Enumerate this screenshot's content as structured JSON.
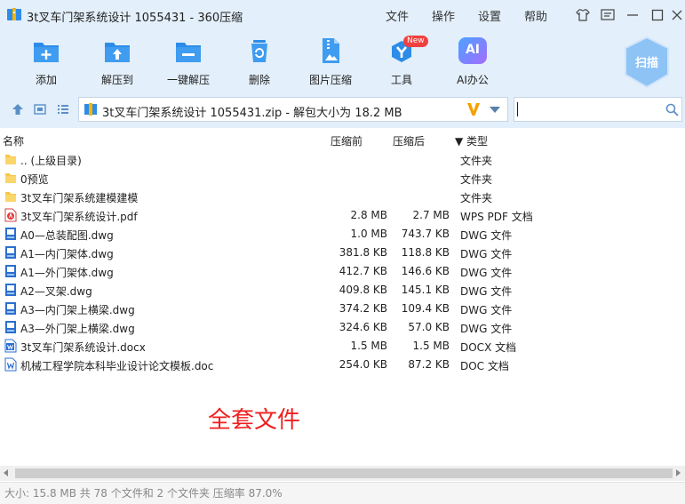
{
  "window": {
    "title": "3t叉车门架系统设计 1055431 - 360压缩",
    "menu": [
      "文件",
      "操作",
      "设置",
      "帮助"
    ],
    "accent": "#2d8ce8",
    "bar_color": "#e3effa"
  },
  "toolbar": {
    "tools": [
      {
        "label": "添加",
        "icon": "add-folder-icon"
      },
      {
        "label": "解压到",
        "icon": "extract-to-icon"
      },
      {
        "label": "一键解压",
        "icon": "one-click-extract-icon"
      },
      {
        "label": "删除",
        "icon": "trash-icon"
      },
      {
        "label": "图片压缩",
        "icon": "image-compress-icon"
      },
      {
        "label": "工具",
        "icon": "tools-icon",
        "badge": "New"
      },
      {
        "label": "AI办公",
        "icon": "ai-office-icon",
        "glyph": "AI"
      }
    ],
    "scan_label": "扫描"
  },
  "address": {
    "path": "3t叉车门架系统设计 1055431.zip - 解包大小为 18.2 MB",
    "search_placeholder": ""
  },
  "columns": {
    "name": "名称",
    "size": "压缩前",
    "packed": "压缩后",
    "type": "▼ 类型"
  },
  "files": [
    {
      "name": ".. (上级目录)",
      "size": "",
      "packed": "",
      "type": "文件夹",
      "icon": "folder-icon"
    },
    {
      "name": "0预览",
      "size": "",
      "packed": "",
      "type": "文件夹",
      "icon": "folder-icon"
    },
    {
      "name": "3t叉车门架系统建模建模",
      "size": "",
      "packed": "",
      "type": "文件夹",
      "icon": "folder-icon"
    },
    {
      "name": "3t叉车门架系统设计.pdf",
      "size": "2.8 MB",
      "packed": "2.7 MB",
      "type": "WPS PDF 文档",
      "icon": "pdf-icon"
    },
    {
      "name": "A0—总装配图.dwg",
      "size": "1.0 MB",
      "packed": "743.7 KB",
      "type": "DWG 文件",
      "icon": "dwg-icon"
    },
    {
      "name": "A1—内门架体.dwg",
      "size": "381.8 KB",
      "packed": "118.8 KB",
      "type": "DWG 文件",
      "icon": "dwg-icon"
    },
    {
      "name": "A1—外门架体.dwg",
      "size": "412.7 KB",
      "packed": "146.6 KB",
      "type": "DWG 文件",
      "icon": "dwg-icon"
    },
    {
      "name": "A2—叉架.dwg",
      "size": "409.8 KB",
      "packed": "145.1 KB",
      "type": "DWG 文件",
      "icon": "dwg-icon"
    },
    {
      "name": "A3—内门架上横梁.dwg",
      "size": "374.2 KB",
      "packed": "109.4 KB",
      "type": "DWG 文件",
      "icon": "dwg-icon"
    },
    {
      "name": "A3—外门架上横梁.dwg",
      "size": "324.6 KB",
      "packed": "57.0 KB",
      "type": "DWG 文件",
      "icon": "dwg-icon"
    },
    {
      "name": "3t叉车门架系统设计.docx",
      "size": "1.5 MB",
      "packed": "1.5 MB",
      "type": "DOCX 文档",
      "icon": "docx-icon"
    },
    {
      "name": "机械工程学院本科毕业设计论文模板.doc",
      "size": "254.0 KB",
      "packed": "87.2 KB",
      "type": "DOC 文档",
      "icon": "doc-icon"
    }
  ],
  "overlay_text": "全套文件",
  "status": "大小: 15.8 MB 共 78 个文件和 2 个文件夹 压缩率 87.0%"
}
